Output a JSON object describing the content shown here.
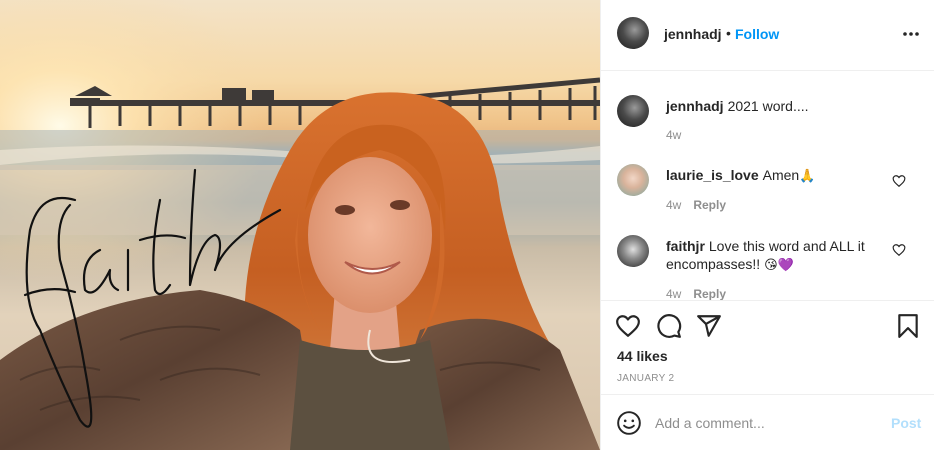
{
  "post": {
    "image_alt": "Selfie of a smiling woman with long red hair in a fur coat at the beach near a pier at sunset, with the word faith handwritten over the photo",
    "handwritten_word": "faith"
  },
  "header": {
    "username": "jennhadj",
    "separator": "•",
    "follow_label": "Follow",
    "more_icon": "more-horizontal-icon"
  },
  "comments": [
    {
      "username": "jennhadj",
      "text": "2021 word....",
      "time": "4w",
      "reply": "",
      "emoji": ""
    },
    {
      "username": "laurie_is_love",
      "text": "Amen",
      "emoji": "🙏",
      "time": "4w",
      "reply": "Reply"
    },
    {
      "username": "faithjr",
      "text": "Love this word and ALL it encompasses!!",
      "emoji": "😘💜",
      "time": "4w",
      "reply": "Reply"
    }
  ],
  "actions": {
    "like_icon": "heart-icon",
    "comment_icon": "comment-icon",
    "share_icon": "paper-plane-icon",
    "save_icon": "bookmark-icon",
    "likes": "44 likes",
    "date": "JANUARY 2"
  },
  "add_comment": {
    "placeholder": "Add a comment...",
    "post_label": "Post",
    "emoji_icon": "smiley-icon"
  },
  "colors": {
    "link_blue": "#0095f6",
    "post_disabled": "#b2dffc",
    "text": "#262626",
    "muted": "#8e8e8e",
    "border": "#efefef"
  }
}
